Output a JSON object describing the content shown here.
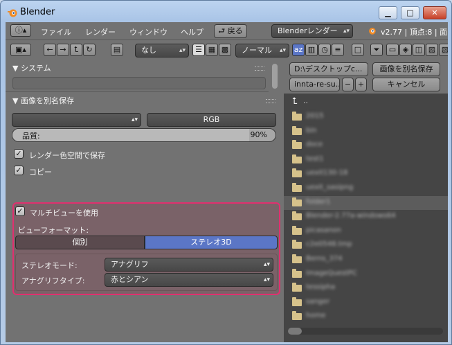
{
  "window": {
    "title": "Blender",
    "minimize": "▁",
    "maximize": "□",
    "close": "✕"
  },
  "info_header": {
    "menus": [
      "ファイル",
      "レンダー",
      "ウィンドウ",
      "ヘルプ"
    ],
    "back_button": "戻る",
    "render_engine": "Blenderレンダー",
    "version_stats": "v2.77 | 頂点:8 | 面:"
  },
  "filebrowser_header": {
    "nav_buttons": [
      "←",
      "→",
      "⮤",
      "↻"
    ],
    "display_select": "なし",
    "sort_select": "ノーマル",
    "path": "D:\\デスクトップc...",
    "filename": "innta-re-su...",
    "save_as_button": "画像を別名保存",
    "cancel_button": "キャンセル",
    "minus": "−",
    "plus": "+"
  },
  "system_panel": {
    "title": "▼ システム"
  },
  "save_panel": {
    "title": "▼ 画像を別名保存",
    "format_select": "",
    "color_mode": "RGB",
    "quality_label": "品質:",
    "quality_value": "90%",
    "quality": 0.9,
    "checkboxes": [
      {
        "label": "レンダー色空間で保存",
        "checked": true
      },
      {
        "label": "コピー",
        "checked": true
      }
    ]
  },
  "multiview": {
    "checkbox_label": "マルチビューを使用",
    "checked": true,
    "views_format_label": "ビューフォーマット:",
    "tab_individual": "個別",
    "tab_stereo": "ステレオ3D",
    "stereo_mode_label": "ステレオモード:",
    "stereo_mode_value": "アナグリフ",
    "anaglyph_type_label": "アナグリフタイプ:",
    "anaglyph_type_value": "赤とシアン"
  },
  "file_list": {
    "parent": "..",
    "items": [
      "2015",
      "bin",
      "doce",
      "test1",
      "uexit130-18",
      "uexit_sasipng",
      "folder1",
      "Blender-2.77a-windows64",
      "picasanon",
      "c2e0548.tmp",
      "Berns_374",
      "ImageQuestPC",
      "tessipha",
      "sanger",
      "home"
    ]
  },
  "colors": {
    "highlight": "#e0306f",
    "accent": "#5b76c6"
  }
}
